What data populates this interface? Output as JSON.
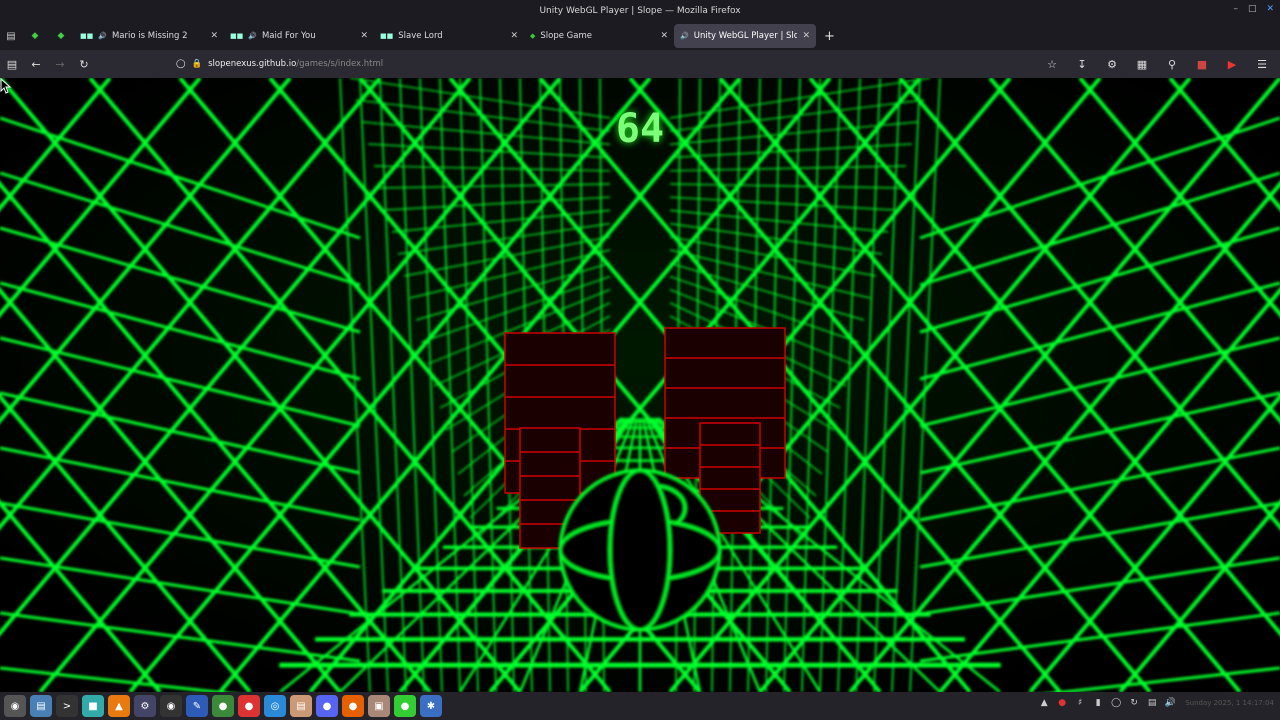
{
  "window": {
    "title": "Unity WebGL Player | Slope — Mozilla Firefox",
    "minimize": "–",
    "maximize": "□",
    "close": "✕"
  },
  "tabs": [
    {
      "label": "Mario is Missing 2",
      "icon": "game-favicon"
    },
    {
      "label": "Maid For You",
      "icon": "game-favicon"
    },
    {
      "label": "Slave Lord",
      "icon": "game-favicon"
    },
    {
      "label": "Slope Game",
      "icon": "game-favicon"
    },
    {
      "label": "Unity WebGL Player | Slope",
      "icon": "audio-icon"
    }
  ],
  "new_tab": "+",
  "url": {
    "domain": "slopenexus.github.io",
    "path": "/games/s/index.html"
  },
  "game": {
    "score": "64"
  },
  "taskbar": {
    "icons": [
      "menu-icon",
      "files-icon",
      "terminal-icon",
      "app-icon",
      "vlc-icon",
      "settings-icon",
      "chrome-icon",
      "editor-icon",
      "browser-icon",
      "vivaldi-icon",
      "folder-icon",
      "discord-icon",
      "firefox-icon",
      "image-icon",
      "android-icon",
      "bluetooth-icon"
    ]
  },
  "clock": "Sunday 2025, 1 14:17:04",
  "colors": {
    "neon_green": "#00ff2a",
    "obstacle_red": "#d00000",
    "score_green": "#7dff7a"
  }
}
